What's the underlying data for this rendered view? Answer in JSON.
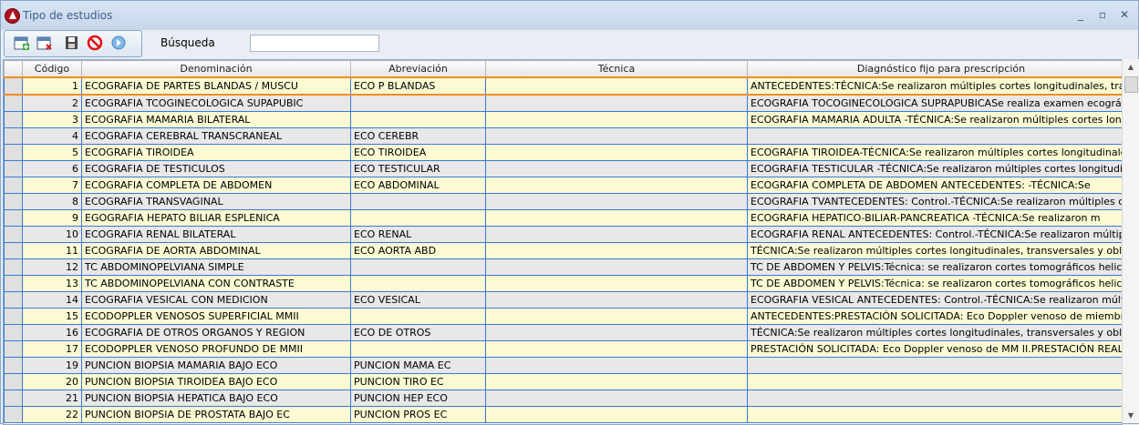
{
  "window": {
    "title": "Tipo de estudios",
    "minimize": "_",
    "maximize": "▫",
    "close": "✕"
  },
  "toolbar": {
    "buttons": [
      {
        "name": "new-record",
        "icon": "calendar-add-icon"
      },
      {
        "name": "delete-record",
        "icon": "calendar-delete-icon"
      },
      {
        "name": "save-record",
        "icon": "floppy-icon"
      },
      {
        "name": "cancel",
        "icon": "no-entry-icon"
      },
      {
        "name": "exit",
        "icon": "exit-icon"
      }
    ],
    "search_label": "Búsqueda",
    "search_value": ""
  },
  "columns": [
    "Código",
    "Denominación",
    "Abreviación",
    "Técnica",
    "Diagnóstico fijo para prescripción"
  ],
  "rows": [
    [
      "1",
      "ECOGRAFIA DE PARTES BLANDAS / MUSCU",
      "ECO P BLANDAS",
      "",
      "ANTECEDENTES:TÉCNICA:Se realizaron múltiples cortes longitudinales, transversales"
    ],
    [
      "2",
      "ECOGRAFIA TCOGINECOLOGICA SUPAPUBIC",
      "",
      "",
      "ECOGRAFIA  TOCOGINECOLOGICA SUPRAPUBICASe realiza examen ecográfico g"
    ],
    [
      "3",
      "ECOGRAFIA MAMARIA BILATERAL",
      "",
      "",
      "ECOGRAFIA MAMARIA ADULTA          -TÉCNICA:Se realizaron múltiples cortes longit"
    ],
    [
      "4",
      "ECOGRAFIA CEREBRAL TRANSCRANEAL",
      "ECO CEREBR",
      "",
      ""
    ],
    [
      "5",
      "ECOGRAFIA TIROIDEA",
      "ECO TIROIDEA",
      "",
      "ECOGRAFIA  TIROIDEA-TÉCNICA:Se realizaron múltiples cortes longitudinales, transv"
    ],
    [
      "6",
      "ECOGRAFIA DE TESTICULOS",
      "ECO TESTICULAR",
      "",
      "ECOGRAFIA TESTICULAR -TÉCNICA:Se realizaron múltiples cortes longitudinales, tra"
    ],
    [
      "7",
      "ECOGRAFIA COMPLETA DE ABDOMEN",
      "ECO ABDOMINAL",
      "",
      "ECOGRAFIA COMPLETA DE ABDOMEN ANTECEDENTES:                 -TÉCNICA:Se"
    ],
    [
      "8",
      "ECOGRAFIA TRANSVAGINAL",
      "",
      "",
      "ECOGRAFIA  TVANTECEDENTES: Control.-TÉCNICA:Se realizaron múltiples cortes l"
    ],
    [
      "9",
      "EGOGRAFIA HEPATO BILIAR ESPLENICA",
      "",
      "",
      "ECOGRAFIA HEPATICO-BILIAR-PANCREATICA                -TÉCNICA:Se realizaron m"
    ],
    [
      "10",
      "ECOGRAFIA RENAL BILATERAL",
      "ECO RENAL",
      "",
      "ECOGRAFIA RENAL ANTECEDENTES: Control.-TÉCNICA:Se realizaron múltiples co"
    ],
    [
      "11",
      "ECOGRAFIA DE AORTA ABDOMINAL",
      "ECO AORTA ABD",
      "",
      "TÉCNICA:Se realizaron múltiples cortes longitudinales, transversales y oblicuos en un e"
    ],
    [
      "12",
      "TC ABDOMINOPELVIANA SIMPLE",
      "",
      "",
      "TC DE ABDOMEN  Y PELVIS:Técnica: se realizaron cortes tomográficos helicoidales"
    ],
    [
      "13",
      "TC ABDOMINOPELVIANA CON CONTRASTE",
      "",
      "",
      "TC DE ABDOMEN  Y PELVIS:Técnica: se realizaron cortes tomográficos helicoidales"
    ],
    [
      "14",
      "ECOGRAFIA VESICAL CON MEDICION",
      "ECO VESICAL",
      "",
      "ECOGRAFIA VESICAL ANTECEDENTES: Control.-TÉCNICA:Se realizaron múltiples c"
    ],
    [
      "15",
      "ECODOPPLER VENOSOS SUPERFICIAL MMII",
      "",
      "",
      "ANTECEDENTES:PRESTACIÓN SOLICITADA: Eco Doppler venoso de miembros inf"
    ],
    [
      "16",
      "ECOGRAFIA DE OTROS ORGANOS Y REGION",
      "ECO DE OTROS",
      "",
      "TÉCNICA:Se realizaron múltiples cortes longitudinales, transversales y oblicuos en un e"
    ],
    [
      "17",
      "ECODOPPLER VENOSO PROFUNDO DE MMII",
      "",
      "",
      "PRESTACIÓN SOLICITADA: Eco Doppler venoso de MM II.PRESTACIÓN REALIZAD"
    ],
    [
      "19",
      "PUNCION BIOPSIA MAMARIA BAJO ECO",
      "PUNCION MAMA EC",
      "",
      ""
    ],
    [
      "20",
      "PUNCION BIOPSIA TIROIDEA BAJO ECO",
      "PUNCION TIRO EC",
      "",
      ""
    ],
    [
      "21",
      "PUNCION BIOPSIA HEPATICA BAJO ECO",
      "PUNCION HEP ECO",
      "",
      ""
    ],
    [
      "22",
      "PUNCION BIOPSIA DE PROSTATA BAJO EC",
      "PUNCION PROS EC",
      "",
      ""
    ]
  ]
}
